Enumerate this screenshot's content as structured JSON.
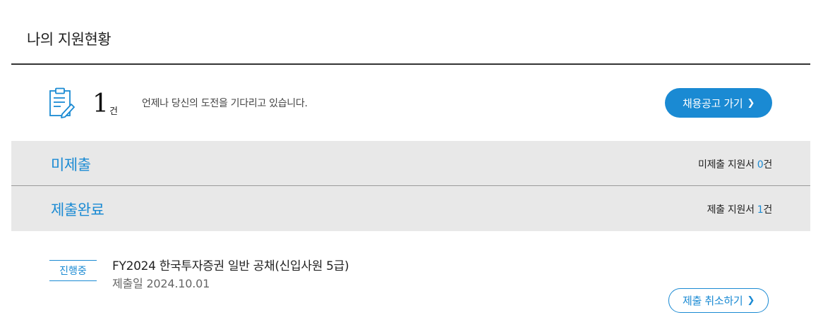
{
  "page": {
    "title": "나의 지원현황"
  },
  "summary": {
    "icon": "clipboard-edit-icon",
    "count": "1",
    "count_unit": "건",
    "message": "언제나 당신의 도전을 기다리고 있습니다.",
    "go_jobs_label": "채용공고 가기",
    "chevron": "❯"
  },
  "sections": [
    {
      "label": "미제출",
      "count_prefix": "미제출 지원서 ",
      "count": "0",
      "count_suffix": "건"
    },
    {
      "label": "제출완료",
      "count_prefix": "제출 지원서 ",
      "count": "1",
      "count_suffix": "건"
    }
  ],
  "applications": [
    {
      "status": "진행중",
      "title": "FY2024 한국투자증권 일반 공채(신입사원 5급)",
      "submitted": "제출일 2024.10.01",
      "cancel_label": "제출 취소하기",
      "chevron": "❯"
    }
  ],
  "colors": {
    "accent": "#1a8ad3",
    "section_bg": "#e8e8e8",
    "rule": "#333333"
  }
}
